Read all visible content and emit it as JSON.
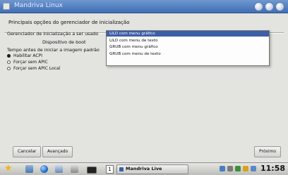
{
  "window": {
    "title": "Mandriva Linux"
  },
  "heading": "Principais opções do gerenciador de inicialização",
  "form": {
    "boot_manager_label": "Gerenciador de inicialização a ser usado",
    "boot_device_label": "Dispositivo de boot",
    "timeout_label": "Tempo antes de iniciar a imagem padrão",
    "bootloader_options": [
      {
        "label": "LILO com menu gráfico",
        "selected": true
      },
      {
        "label": "LILO com menu de texto",
        "selected": false
      },
      {
        "label": "GRUB com menu gráfico",
        "selected": false
      },
      {
        "label": "GRUB com menu de texto",
        "selected": false
      }
    ],
    "options": [
      {
        "label": "Habilitar ACPI",
        "checked": true
      },
      {
        "label": "Forçar sem APIC",
        "checked": false
      },
      {
        "label": "Forçar sem APIC Local",
        "checked": false
      }
    ]
  },
  "buttons": {
    "cancel": "Cancelar",
    "advanced": "Avançado",
    "next": "Próximo"
  },
  "taskbar": {
    "workspace": "1",
    "task_label": "Mandriva Live",
    "clock": "11:58"
  },
  "colors": {
    "selection": "#3d5fa8",
    "titlebar": "#3f6eb5"
  }
}
